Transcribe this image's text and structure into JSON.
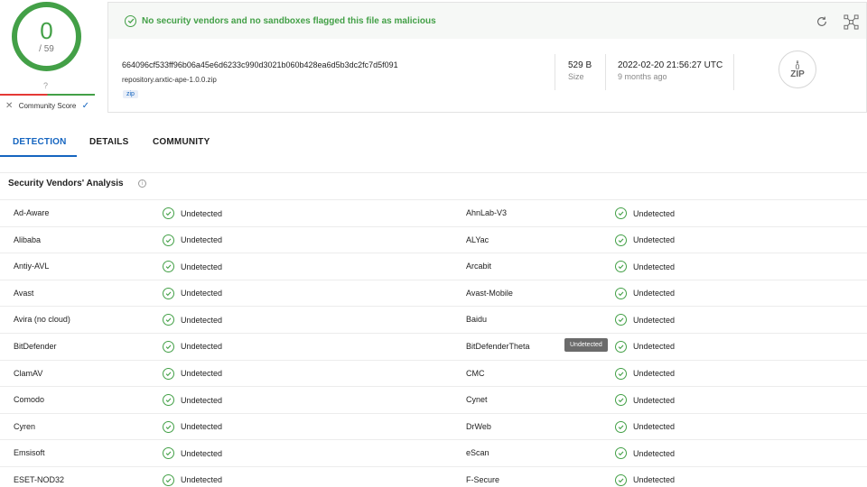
{
  "score": {
    "value": "0",
    "total": "/ 59",
    "question": "?",
    "community_label": "Community Score"
  },
  "summary": {
    "message": "No security vendors and no sandboxes flagged this file as malicious",
    "hash": "664096cf533ff96b06a45e6d6233c990d3021b060b428ea6d5b3dc2fc7d5f091",
    "filename": "repository.arxtic-ape-1.0.0.zip",
    "tag": "zip",
    "size_value": "529 B",
    "size_label": "Size",
    "date_value": "2022-02-20 21:56:27 UTC",
    "date_ago": "9 months ago",
    "file_type": "ZIP"
  },
  "tabs": [
    {
      "label": "DETECTION"
    },
    {
      "label": "DETAILS"
    },
    {
      "label": "COMMUNITY"
    }
  ],
  "section": {
    "title": "Security Vendors' Analysis"
  },
  "tooltip": "Undetected",
  "vendors": [
    {
      "left": "Ad-Aware",
      "left_result": "Undetected",
      "right": "AhnLab-V3",
      "right_result": "Undetected"
    },
    {
      "left": "Alibaba",
      "left_result": "Undetected",
      "right": "ALYac",
      "right_result": "Undetected"
    },
    {
      "left": "Antiy-AVL",
      "left_result": "Undetected",
      "right": "Arcabit",
      "right_result": "Undetected"
    },
    {
      "left": "Avast",
      "left_result": "Undetected",
      "right": "Avast-Mobile",
      "right_result": "Undetected"
    },
    {
      "left": "Avira (no cloud)",
      "left_result": "Undetected",
      "right": "Baidu",
      "right_result": "Undetected"
    },
    {
      "left": "BitDefender",
      "left_result": "Undetected",
      "right": "BitDefenderTheta",
      "right_result": "Undetected"
    },
    {
      "left": "ClamAV",
      "left_result": "Undetected",
      "right": "CMC",
      "right_result": "Undetected"
    },
    {
      "left": "Comodo",
      "left_result": "Undetected",
      "right": "Cynet",
      "right_result": "Undetected"
    },
    {
      "left": "Cyren",
      "left_result": "Undetected",
      "right": "DrWeb",
      "right_result": "Undetected"
    },
    {
      "left": "Emsisoft",
      "left_result": "Undetected",
      "right": "eScan",
      "right_result": "Undetected"
    },
    {
      "left": "ESET-NOD32",
      "left_result": "Undetected",
      "right": "F-Secure",
      "right_result": "Undetected"
    }
  ],
  "colors": {
    "clean": "#43a047",
    "accent": "#1565c0",
    "danger": "#e53935"
  }
}
